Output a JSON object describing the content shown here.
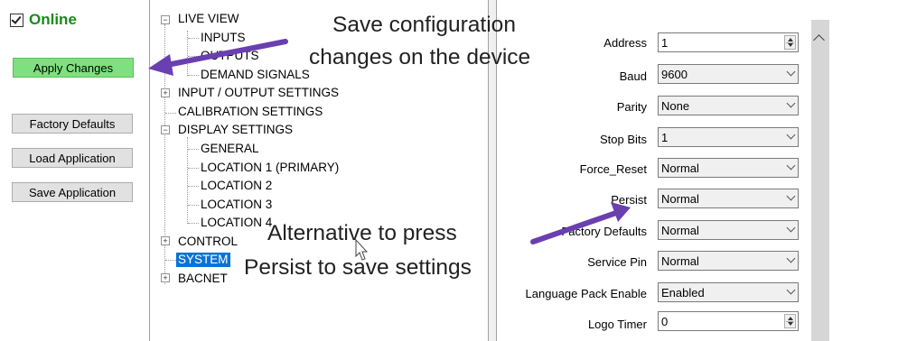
{
  "status": {
    "online_label": "Online",
    "online_checked": true
  },
  "buttons": {
    "apply": "Apply Changes",
    "factory_defaults": "Factory Defaults",
    "load_application": "Load Application",
    "save_application": "Save Application"
  },
  "tree": {
    "live_view": "LIVE VIEW",
    "inputs": "INPUTS",
    "outputs": "OUTPUTS",
    "demand_signals": "DEMAND SIGNALS",
    "io_settings": "INPUT / OUTPUT SETTINGS",
    "calibration": "CALIBRATION SETTINGS",
    "display_settings": "DISPLAY SETTINGS",
    "general": "GENERAL",
    "location1": "LOCATION 1 (PRIMARY)",
    "location2": "LOCATION 2",
    "location3": "LOCATION 3",
    "location4": "LOCATION 4",
    "control": "CONTROL",
    "system": "SYSTEM",
    "bacnet": "BACNET"
  },
  "properties": {
    "address": {
      "label": "Address",
      "value": "1"
    },
    "baud": {
      "label": "Baud",
      "value": "9600"
    },
    "parity": {
      "label": "Parity",
      "value": "None"
    },
    "stop_bits": {
      "label": "Stop Bits",
      "value": "1"
    },
    "force_reset": {
      "label": "Force_Reset",
      "value": "Normal"
    },
    "persist": {
      "label": "Persist",
      "value": "Normal"
    },
    "factory_defaults": {
      "label": "Factory Defaults",
      "value": "Normal"
    },
    "service_pin": {
      "label": "Service Pin",
      "value": "Normal"
    },
    "language_pack": {
      "label": "Language Pack Enable",
      "value": "Enabled"
    },
    "logo_timer": {
      "label": "Logo Timer",
      "value": "0"
    }
  },
  "annotations": {
    "save_line1": "Save configuration",
    "save_line2": "changes on the device",
    "alt_line1": "Alternative to press",
    "alt_line2": "Persist to save settings",
    "arrow_color": "#6a3fb0"
  }
}
